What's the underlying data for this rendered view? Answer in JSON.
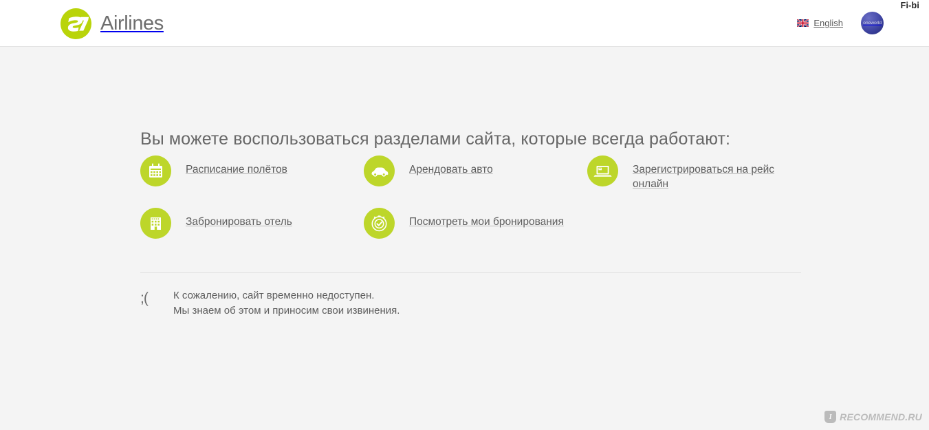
{
  "overlay": {
    "top_right_label": "Fi-bi"
  },
  "header": {
    "logo": {
      "mark_text": "S7",
      "word": "Airlines",
      "color": "#b9d40a"
    },
    "language": {
      "label": "English",
      "flag_icon": "uk-flag-icon"
    },
    "alliance": {
      "label": "oneworld",
      "color": "#3a3f9e"
    }
  },
  "main": {
    "heading": "Вы можете воспользоваться разделами сайта, которые всегда работают:",
    "accent_color": "#bdd62a",
    "links": [
      {
        "icon": "calendar-icon",
        "label": "Расписание полётов"
      },
      {
        "icon": "car-icon",
        "label": "Арендовать авто"
      },
      {
        "icon": "laptop-icon",
        "label": "Зарегистрироваться на рейс онлайн"
      },
      {
        "icon": "hotel-icon",
        "label": "Забронировать отель"
      },
      {
        "icon": "check-circle-icon",
        "label": "Посмотреть мои бронирования"
      }
    ],
    "message": {
      "emoticon": ";(",
      "line1": "К сожалению, сайт временно недоступен.",
      "line2": "Мы знаем об этом и приносим свои извинения."
    }
  },
  "watermark": {
    "badge": "I",
    "text": "RECOMMEND.RU"
  }
}
